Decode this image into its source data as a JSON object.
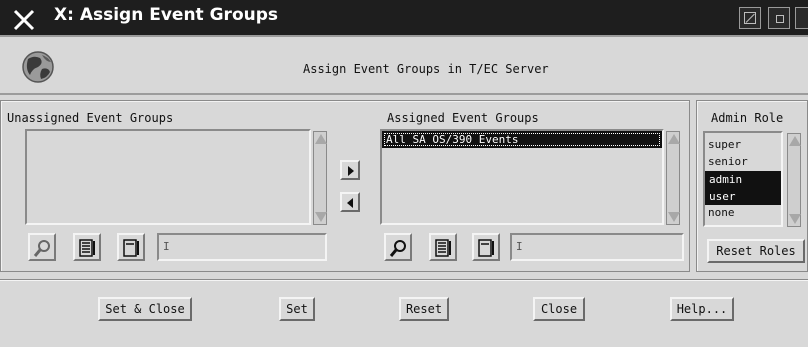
{
  "window": {
    "title": "X: Assign Event Groups"
  },
  "header": {
    "title": "Assign Event Groups in T/EC Server",
    "icon": "globe-icon"
  },
  "unassigned": {
    "label": "Unassigned Event Groups",
    "items": [],
    "filter_value": "I"
  },
  "assigned": {
    "label": "Assigned Event Groups",
    "items": [
      "All SA OS/390 Events"
    ],
    "filter_value": "I"
  },
  "roles": {
    "label": "Admin Role",
    "items": [
      "super",
      "senior",
      "admin",
      "user",
      "none"
    ],
    "selected": [
      "admin",
      "user"
    ],
    "reset_label": "Reset Roles"
  },
  "buttons": {
    "set_close": "Set & Close",
    "set": "Set",
    "reset": "Reset",
    "close": "Close",
    "help": "Help..."
  },
  "colors": {
    "window_bg": "#d8d8d8",
    "titlebar_bg": "#1e1e1e",
    "selection_bg": "#111111"
  }
}
